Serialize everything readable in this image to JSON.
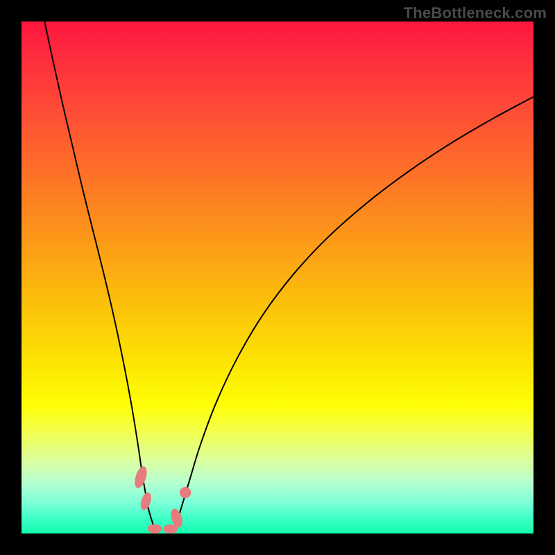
{
  "watermark": "TheBottleneck.com",
  "chart_data": {
    "type": "line",
    "title": "",
    "xlabel": "",
    "ylabel": "",
    "xlim": [
      0,
      100
    ],
    "ylim": [
      0,
      100
    ],
    "series": [
      {
        "name": "left-curve",
        "x": [
          4.5,
          6,
          8,
          10,
          12,
          14,
          16,
          18,
          20,
          21.5,
          22.8,
          23.6,
          24.2,
          24.7,
          25.4,
          26
        ],
        "y": [
          100,
          93,
          84,
          75.5,
          67,
          59,
          51,
          42.5,
          33,
          25,
          17,
          11.5,
          8,
          5.2,
          2.7,
          1.0
        ]
      },
      {
        "name": "right-curve",
        "x": [
          30,
          30.6,
          31.5,
          33,
          35,
          38,
          42,
          47,
          53,
          60,
          68,
          76,
          84,
          92,
          100
        ],
        "y": [
          1.0,
          3.0,
          6.0,
          11,
          17.5,
          25.5,
          34,
          42.5,
          50.5,
          58,
          65,
          71,
          76.3,
          81,
          85.3
        ]
      }
    ],
    "markers": [
      {
        "name": "left-upper-blob",
        "cx": 23.3,
        "cy": 11.0,
        "rx": 1.0,
        "ry": 2.2,
        "rot": 18
      },
      {
        "name": "left-lower-blob",
        "cx": 24.3,
        "cy": 6.3,
        "rx": 0.9,
        "ry": 1.8,
        "rot": 18
      },
      {
        "name": "right-upper-dot",
        "cx": 32.0,
        "cy": 8.0,
        "rx": 1.1,
        "ry": 1.1,
        "rot": 0
      },
      {
        "name": "right-lower-blob",
        "cx": 30.3,
        "cy": 3.0,
        "rx": 1.0,
        "ry": 1.9,
        "rot": -18
      },
      {
        "name": "bottom-left-blob",
        "cx": 26.0,
        "cy": 0.9,
        "rx": 1.4,
        "ry": 0.9,
        "rot": 0
      },
      {
        "name": "bottom-right-blob",
        "cx": 29.1,
        "cy": 0.9,
        "rx": 1.4,
        "ry": 0.9,
        "rot": 0
      }
    ],
    "gradient_stops": [
      {
        "pos": 0,
        "color": "#fe163e"
      },
      {
        "pos": 7,
        "color": "#fe2d3e"
      },
      {
        "pos": 18,
        "color": "#fe4e35"
      },
      {
        "pos": 30,
        "color": "#fd7227"
      },
      {
        "pos": 43,
        "color": "#fc9a18"
      },
      {
        "pos": 56,
        "color": "#fbc309"
      },
      {
        "pos": 68,
        "color": "#fde902"
      },
      {
        "pos": 75,
        "color": "#feff06"
      },
      {
        "pos": 80,
        "color": "#f3ff4d"
      },
      {
        "pos": 86,
        "color": "#d9ffa2"
      },
      {
        "pos": 90,
        "color": "#b6ffd0"
      },
      {
        "pos": 94,
        "color": "#7dffd8"
      },
      {
        "pos": 97,
        "color": "#3effc7"
      },
      {
        "pos": 100,
        "color": "#13fdad"
      }
    ]
  }
}
